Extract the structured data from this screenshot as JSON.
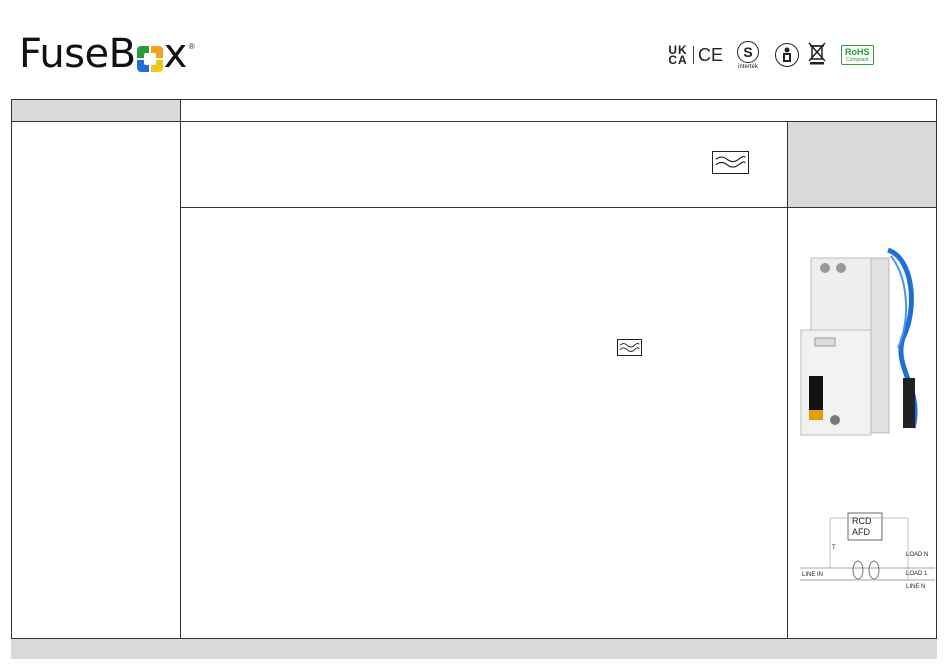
{
  "brand": {
    "logo_prefix": "FuseB",
    "logo_suffix": "x",
    "registered_mark": "®"
  },
  "certifications": {
    "ukca_top": "UK",
    "ukca_bottom": "CA",
    "ce": "CE",
    "intertek_symbol": "S",
    "intertek_label": "intertek",
    "manual_icon": "read-manual-icon",
    "weee_icon": "weee-crossed-bin-icon",
    "rohs_title": "RoHS",
    "rohs_subtitle": "Compliant"
  },
  "colors": {
    "header_band": "#d9d9d9",
    "rohs_green": "#2d9b3a",
    "cable_blue": "#1f6fd6",
    "device_white": "#eeeeee"
  },
  "diagram": {
    "box_line1": "RCD",
    "box_line2": "AFD",
    "test_label": "T",
    "load_n": "LOAD N",
    "load_1": "LOAD 1",
    "line_in": "LINE IN",
    "line_n": "LINE N"
  }
}
